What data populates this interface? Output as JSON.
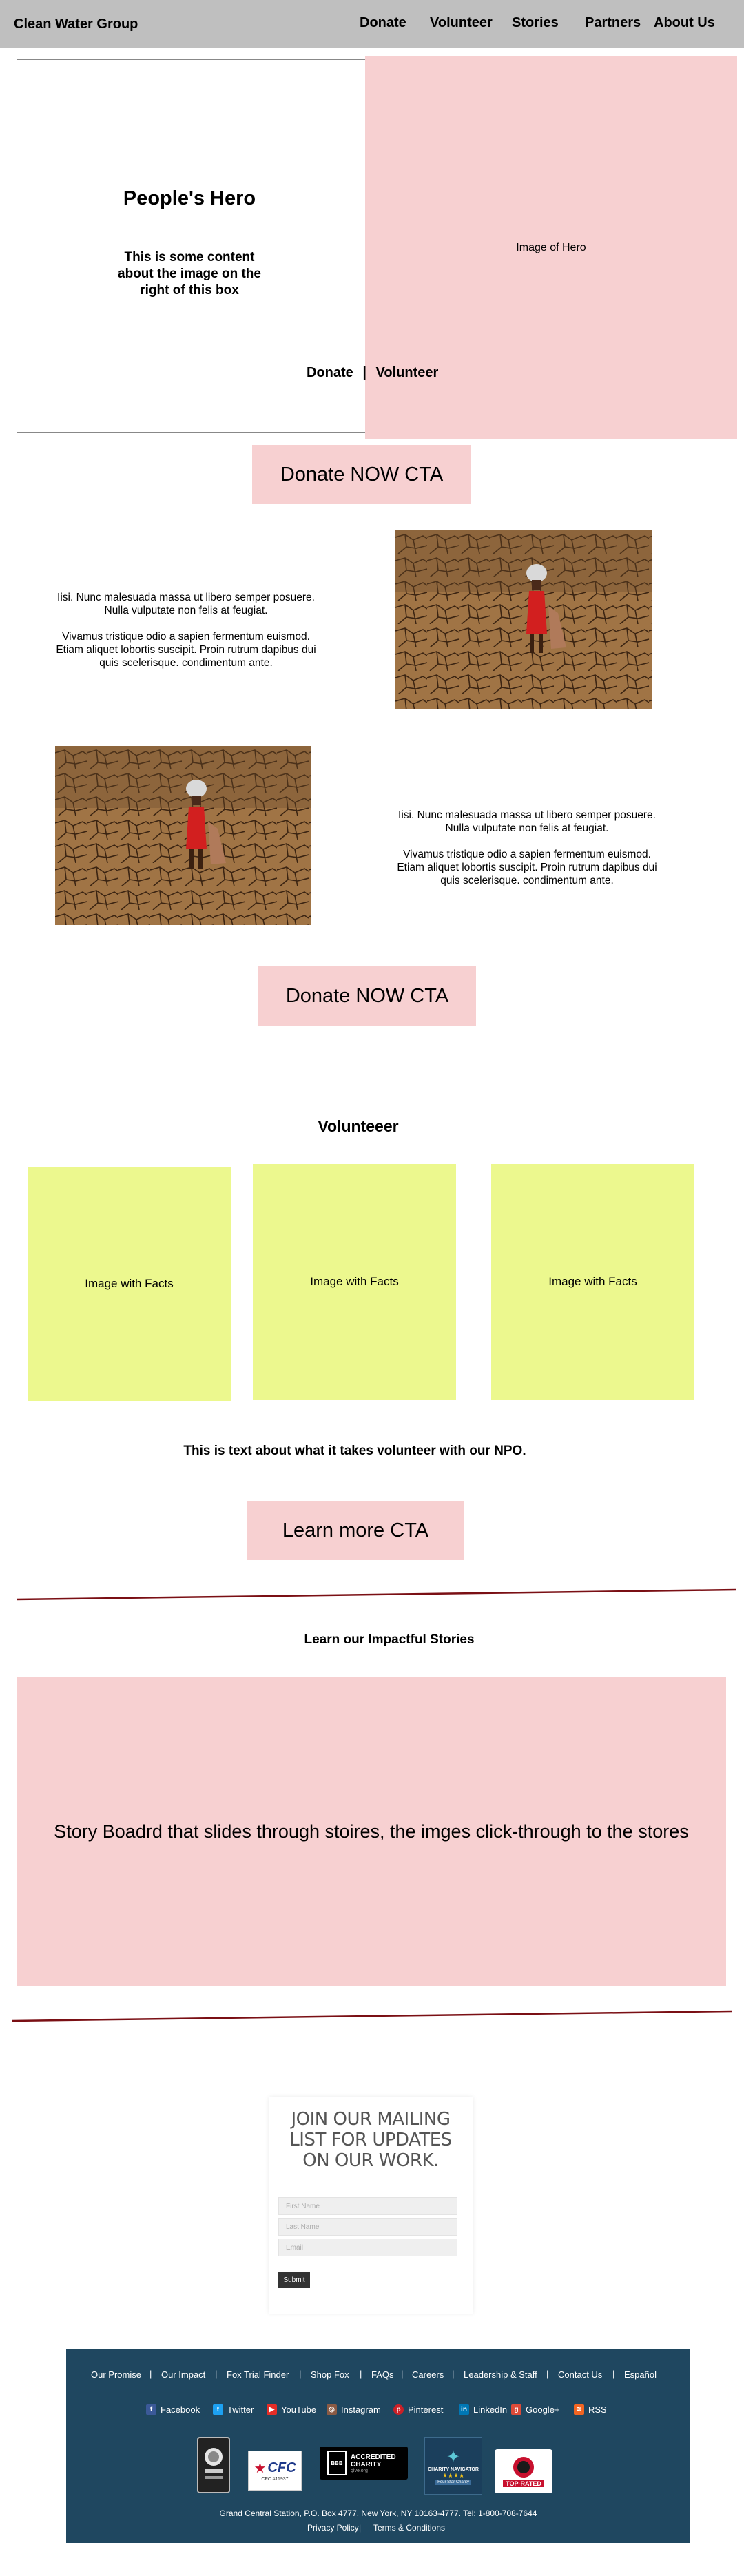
{
  "header": {
    "brand": "Clean Water Group",
    "nav": [
      "Donate",
      "Volunteer",
      "Stories",
      "Partners",
      "About Us"
    ]
  },
  "hero": {
    "title": "People's Hero",
    "subtitle": "This is some content about the image on the right of this box",
    "image_label": "Image of Hero",
    "link_donate": "Donate",
    "link_separator": "|",
    "link_volunteer": "Volunteer"
  },
  "cta_donate_1": "Donate NOW CTA",
  "cta_donate_2": "Donate NOW CTA",
  "content_block": {
    "line1": "Iisi. Nunc malesuada massa ut libero semper posuere. Nulla vulputate non felis at feugiat.",
    "line2": "Vivamus tristique odio a sapien fermentum euismod. Etiam aliquet lobortis suscipit. Proin rutrum dapibus dui quis scelerisque. condimentum ante."
  },
  "volunteer": {
    "heading": "Volunteeer",
    "cards": [
      "Image with Facts",
      "Image with Facts",
      "Image with Facts"
    ],
    "text": "This is text about what it takes volunteer with our NPO.",
    "cta": "Learn more CTA"
  },
  "stories": {
    "heading": "Learn our Impactful Stories",
    "board": "Story Boadrd that slides through stoires, the imges  click-through to the stores"
  },
  "mailing": {
    "title": "JOIN OUR MAILING LIST FOR UPDATES ON OUR WORK.",
    "first_name_placeholder": "First Name",
    "last_name_placeholder": "Last Name",
    "email_placeholder": "Email",
    "submit": "Submit"
  },
  "footer": {
    "links": [
      "Our Promise",
      "Our Impact",
      "Fox Trial Finder",
      "Shop Fox",
      "FAQs",
      "Careers",
      "Leadership & Staff",
      "Contact Us",
      "Español"
    ],
    "social": [
      "Facebook",
      "Twitter",
      "YouTube",
      "Instagram",
      "Pinterest",
      "LinkedIn",
      "Google+",
      "RSS"
    ],
    "badges": {
      "cfc": "CFC",
      "cfc_small": "CFC #11937",
      "bbb_top": "BBB",
      "bbb_main": "ACCREDITED CHARITY",
      "bbb_sub": "give.org",
      "cn_top": "CHARITY NAVIGATOR",
      "cn_sub": "Four Star Charity",
      "tr": "TOP-RATED"
    },
    "address": "Grand Central Station, P.O. Box 4777, New York, NY 10163-4777. Tel: 1-800-708-7644",
    "privacy": "Privacy Policy",
    "terms": "Terms & Conditions"
  },
  "colors": {
    "header_bg": "#bfbfbf",
    "cta_pink": "#f7d0d1",
    "fact_yellow": "#ecf88e",
    "divider_red": "#7a0f14",
    "footer_navy": "#1f4760"
  }
}
